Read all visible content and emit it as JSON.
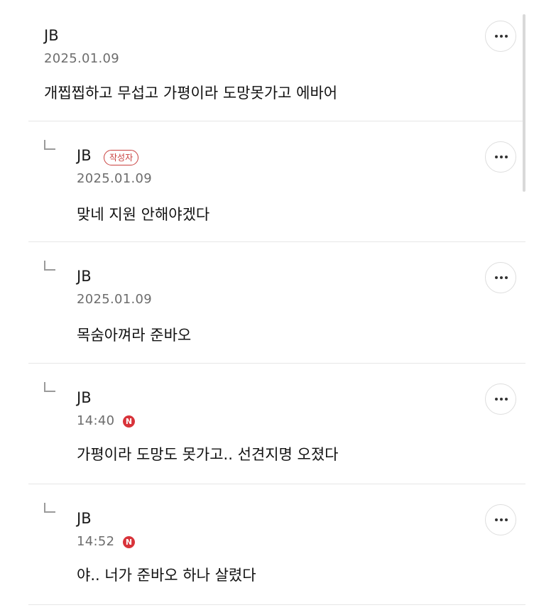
{
  "comments": [
    {
      "author": "JB",
      "date": "2025.01.09",
      "text": "개찝찝하고 무섭고 가평이라 도망못가고 에바어",
      "reply": false,
      "more_icon": "more-dots-icon"
    },
    {
      "author": "JB",
      "badge": "작성자",
      "date": "2025.01.09",
      "text": "맞네 지원 안해야겠다",
      "reply": true,
      "more_icon": "more-dots-icon"
    },
    {
      "author": "JB",
      "date": "2025.01.09",
      "text": "목숨아껴라 준바오",
      "reply": true,
      "more_icon": "more-dots-icon"
    },
    {
      "author": "JB",
      "date": "14:40",
      "new_badge": "N",
      "text": "가평이라 도망도 못가고.. 선견지명 오졌다",
      "reply": true,
      "more_icon": "more-dots-icon"
    },
    {
      "author": "JB",
      "date": "14:52",
      "new_badge": "N",
      "text": "야.. 너가 준바오 하나 살렸다",
      "reply": true,
      "more_icon": "more-dots-icon"
    }
  ],
  "colors": {
    "accent_red": "#d8333a",
    "badge_red": "#c9403e",
    "meta_gray": "#6d6d6d",
    "divider": "#e6e6e6"
  }
}
